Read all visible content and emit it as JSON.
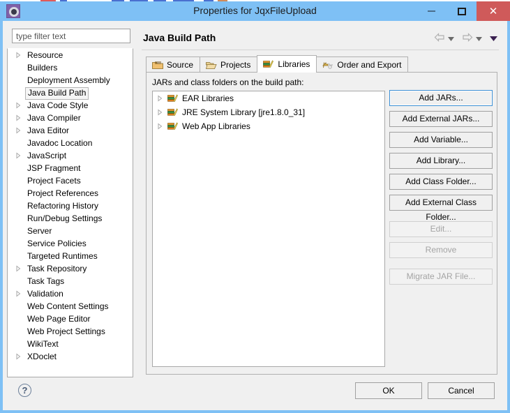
{
  "window": {
    "title": "Properties for JqxFileUpload",
    "app_icon": "eclipse-gear-icon",
    "minimize_label": "–",
    "maximize_label": "□",
    "close_label": "✕",
    "frame_color": "#7ec0f5",
    "close_color": "#cf5a5a"
  },
  "filter": {
    "placeholder": "type filter text",
    "value": ""
  },
  "sidebar": {
    "items": [
      {
        "label": "Resource",
        "expandable": true,
        "selected": false
      },
      {
        "label": "Builders",
        "expandable": false,
        "selected": false
      },
      {
        "label": "Deployment Assembly",
        "expandable": false,
        "selected": false
      },
      {
        "label": "Java Build Path",
        "expandable": false,
        "selected": true
      },
      {
        "label": "Java Code Style",
        "expandable": true,
        "selected": false
      },
      {
        "label": "Java Compiler",
        "expandable": true,
        "selected": false
      },
      {
        "label": "Java Editor",
        "expandable": true,
        "selected": false
      },
      {
        "label": "Javadoc Location",
        "expandable": false,
        "selected": false
      },
      {
        "label": "JavaScript",
        "expandable": true,
        "selected": false
      },
      {
        "label": "JSP Fragment",
        "expandable": false,
        "selected": false
      },
      {
        "label": "Project Facets",
        "expandable": false,
        "selected": false
      },
      {
        "label": "Project References",
        "expandable": false,
        "selected": false
      },
      {
        "label": "Refactoring History",
        "expandable": false,
        "selected": false
      },
      {
        "label": "Run/Debug Settings",
        "expandable": false,
        "selected": false
      },
      {
        "label": "Server",
        "expandable": false,
        "selected": false
      },
      {
        "label": "Service Policies",
        "expandable": false,
        "selected": false
      },
      {
        "label": "Targeted Runtimes",
        "expandable": false,
        "selected": false
      },
      {
        "label": "Task Repository",
        "expandable": true,
        "selected": false
      },
      {
        "label": "Task Tags",
        "expandable": false,
        "selected": false
      },
      {
        "label": "Validation",
        "expandable": true,
        "selected": false
      },
      {
        "label": "Web Content Settings",
        "expandable": false,
        "selected": false
      },
      {
        "label": "Web Page Editor",
        "expandable": false,
        "selected": false
      },
      {
        "label": "Web Project Settings",
        "expandable": false,
        "selected": false
      },
      {
        "label": "WikiText",
        "expandable": false,
        "selected": false
      },
      {
        "label": "XDoclet",
        "expandable": true,
        "selected": false
      }
    ]
  },
  "page": {
    "title": "Java Build Path",
    "nav": {
      "back_icon": "back-arrow-icon",
      "back_menu_icon": "chevron-down-icon",
      "forward_icon": "forward-arrow-icon",
      "forward_menu_icon": "chevron-down-icon",
      "menu_icon": "chevron-down-filled-icon"
    }
  },
  "tabs": [
    {
      "label": "Source",
      "icon": "source-folder-icon",
      "active": false
    },
    {
      "label": "Projects",
      "icon": "open-folder-icon",
      "active": false
    },
    {
      "label": "Libraries",
      "icon": "library-books-icon",
      "active": true
    },
    {
      "label": "Order and Export",
      "icon": "order-export-arrows-icon",
      "active": false
    }
  ],
  "libraries_tab": {
    "label": "JARs and class folders on the build path:",
    "tree_items": [
      {
        "label": "EAR Libraries",
        "icon": "library-books-icon",
        "expandable": true
      },
      {
        "label": "JRE System Library [jre1.8.0_31]",
        "icon": "library-books-icon",
        "expandable": true
      },
      {
        "label": "Web App Libraries",
        "icon": "library-books-icon",
        "expandable": true
      }
    ],
    "buttons": [
      {
        "label": "Add JARs...",
        "enabled": true,
        "focused": true,
        "spacer": false
      },
      {
        "label": "Add External JARs...",
        "enabled": true,
        "focused": false,
        "spacer": false
      },
      {
        "label": "Add Variable...",
        "enabled": true,
        "focused": false,
        "spacer": false
      },
      {
        "label": "Add Library...",
        "enabled": true,
        "focused": false,
        "spacer": false
      },
      {
        "label": "Add Class Folder...",
        "enabled": true,
        "focused": false,
        "spacer": false
      },
      {
        "label": "Add External Class Folder...",
        "enabled": true,
        "focused": false,
        "spacer": false
      },
      {
        "label": "Edit...",
        "enabled": false,
        "focused": false,
        "spacer": true
      },
      {
        "label": "Remove",
        "enabled": false,
        "focused": false,
        "spacer": false
      },
      {
        "label": "Migrate JAR File...",
        "enabled": false,
        "focused": false,
        "spacer": true
      }
    ]
  },
  "footer": {
    "help_icon": "help-question-icon",
    "help_label": "?",
    "ok_label": "OK",
    "cancel_label": "Cancel"
  }
}
